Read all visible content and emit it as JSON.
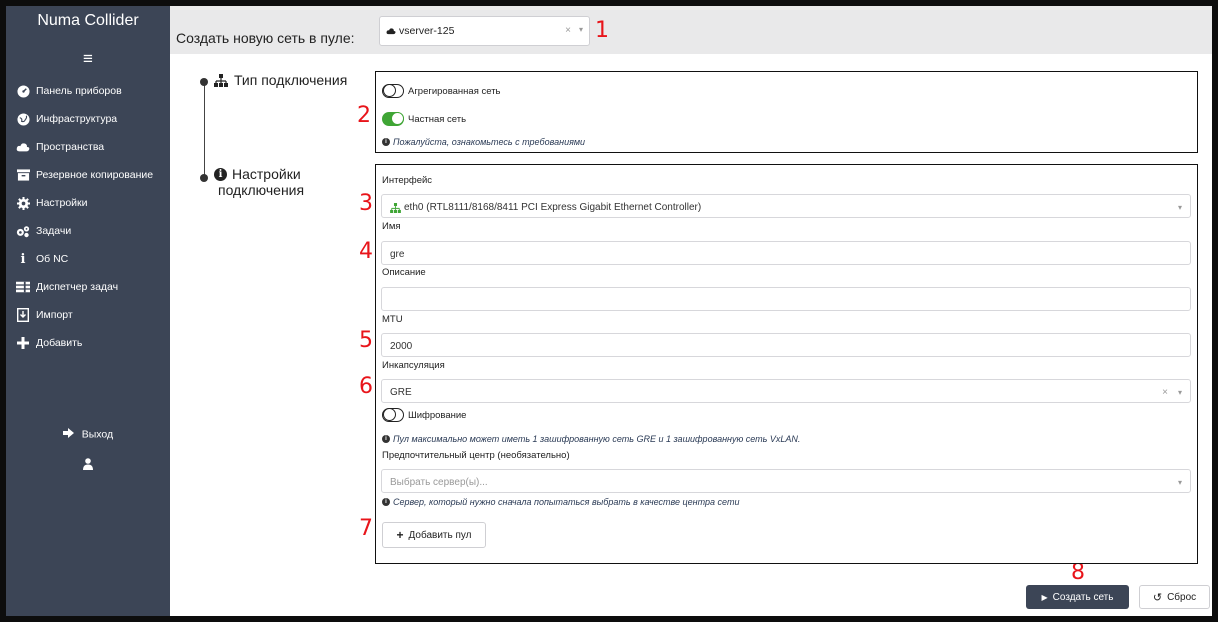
{
  "app": {
    "title": "Numa Collider"
  },
  "sidebar": {
    "menu_icon": "hamburger-icon",
    "items": [
      {
        "label": "Панель приборов",
        "icon": "dashboard-icon"
      },
      {
        "label": "Инфраструктура",
        "icon": "globe-icon"
      },
      {
        "label": "Пространства",
        "icon": "cloud-icon"
      },
      {
        "label": "Резервное копирование",
        "icon": "archive-icon"
      },
      {
        "label": "Настройки",
        "icon": "gear-icon"
      },
      {
        "label": "Задачи",
        "icon": "gears-icon"
      },
      {
        "label": "Об NC",
        "icon": "info-icon"
      },
      {
        "label": "Диспетчер задач",
        "icon": "tasks-icon"
      },
      {
        "label": "Импорт",
        "icon": "import-icon"
      },
      {
        "label": "Добавить",
        "icon": "plus-icon"
      }
    ],
    "logout_label": "Выход",
    "user_icon": "user-icon"
  },
  "header": {
    "pool_label": "Создать новую сеть в пуле:",
    "pool_value": "vserver-125"
  },
  "annotations": [
    "1",
    "2",
    "3",
    "4",
    "5",
    "6",
    "7",
    "8"
  ],
  "connection_type": {
    "title": "Тип подключения",
    "aggregated_label": "Агрегированная сеть",
    "aggregated_on": false,
    "private_label": "Частная сеть",
    "private_on": true,
    "hint": "Пожалуйста, ознакомьтесь с требованиями"
  },
  "connection_settings": {
    "title_line1": "Настройки",
    "title_line2": "подключения",
    "interface_label": "Интерфейс",
    "interface_value": "eth0 (RTL8111/8168/8411 PCI Express Gigabit Ethernet Controller)",
    "name_label": "Имя",
    "name_value": "gre",
    "description_label": "Описание",
    "description_value": "",
    "mtu_label": "MTU",
    "mtu_value": "2000",
    "encapsulation_label": "Инкапсуляция",
    "encapsulation_value": "GRE",
    "encryption_label": "Шифрование",
    "encryption_on": false,
    "encryption_hint": "Пул максимально может иметь 1 зашифрованную сеть GRE и 1 зашифрованную сеть VxLAN.",
    "preferred_center_label": "Предпочтительный центр (необязательно)",
    "preferred_center_placeholder": "Выбрать сервер(ы)...",
    "preferred_center_hint": "Сервер, который нужно сначала попытаться выбрать в качестве центра сети",
    "add_pool_label": "Добавить пул"
  },
  "footer": {
    "create_label": "Создать сеть",
    "reset_label": "Сброс"
  },
  "colors": {
    "sidebar_bg": "#3c4556",
    "toggle_on": "#3fa535",
    "annotation_red": "#e8141a",
    "network_icon_green": "#3fa535"
  }
}
